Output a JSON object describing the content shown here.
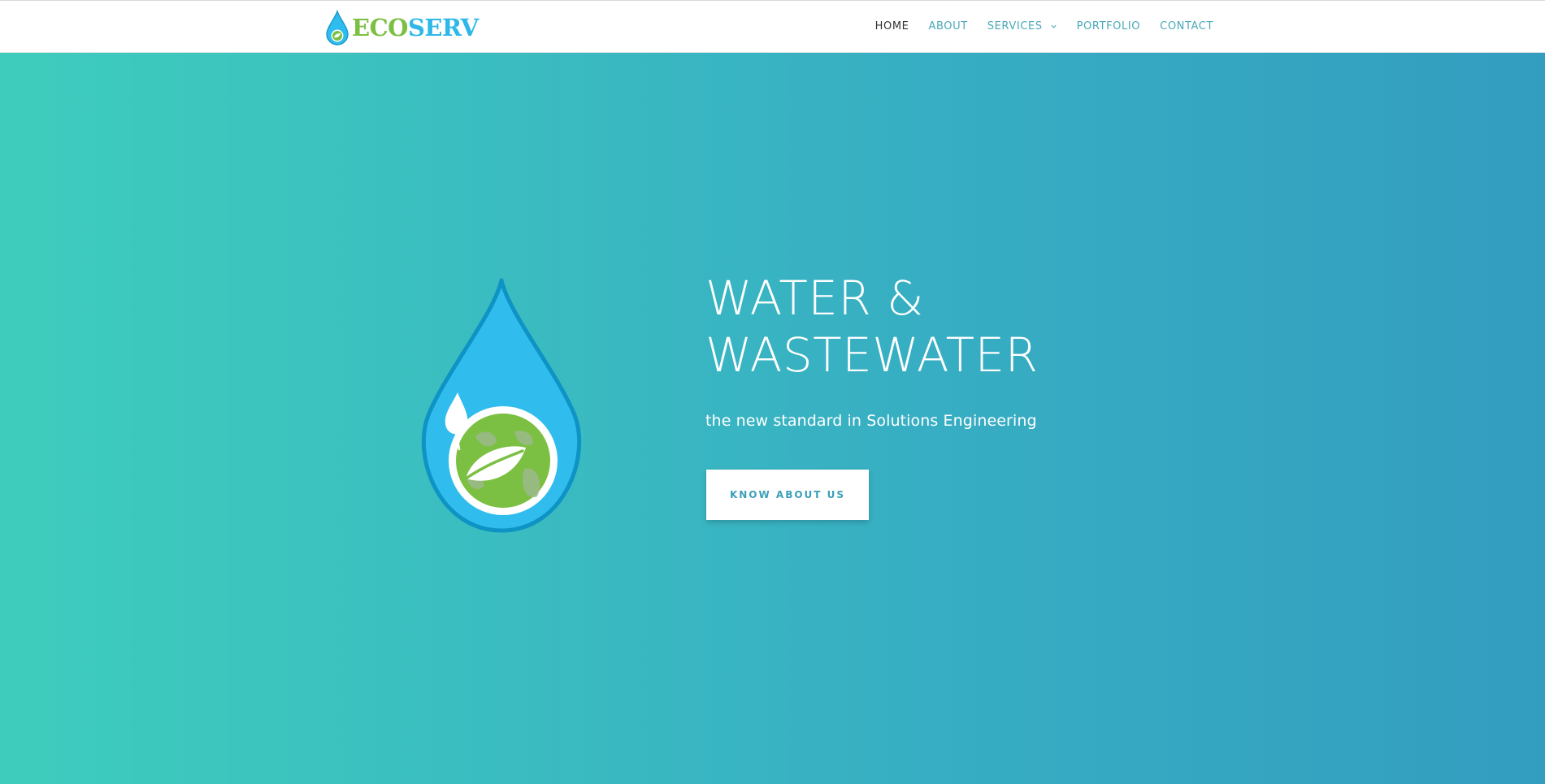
{
  "brand": {
    "name_part1": "ECO",
    "name_part2": "SERV",
    "colors": {
      "green": "#7bc043",
      "blue": "#2db8e8"
    }
  },
  "nav": {
    "items": [
      {
        "label": "HOME",
        "active": true
      },
      {
        "label": "ABOUT"
      },
      {
        "label": "SERVICES",
        "icon": "chevron-down-icon"
      },
      {
        "label": "PORTFOLIO"
      },
      {
        "label": "CONTACT"
      }
    ]
  },
  "hero": {
    "title_line1": "WATER &",
    "title_line2": "WASTEWATER",
    "subtitle": "the new standard in Solutions Engineering",
    "button_label": "KNOW ABOUT US",
    "icon": "water-drop-earth-icon"
  },
  "colors": {
    "nav_text": "#4aa9b8",
    "nav_active": "#333333",
    "gradient_start": "#3ecdbd",
    "gradient_end": "#339dc0",
    "button_text": "#3a9fb8"
  }
}
